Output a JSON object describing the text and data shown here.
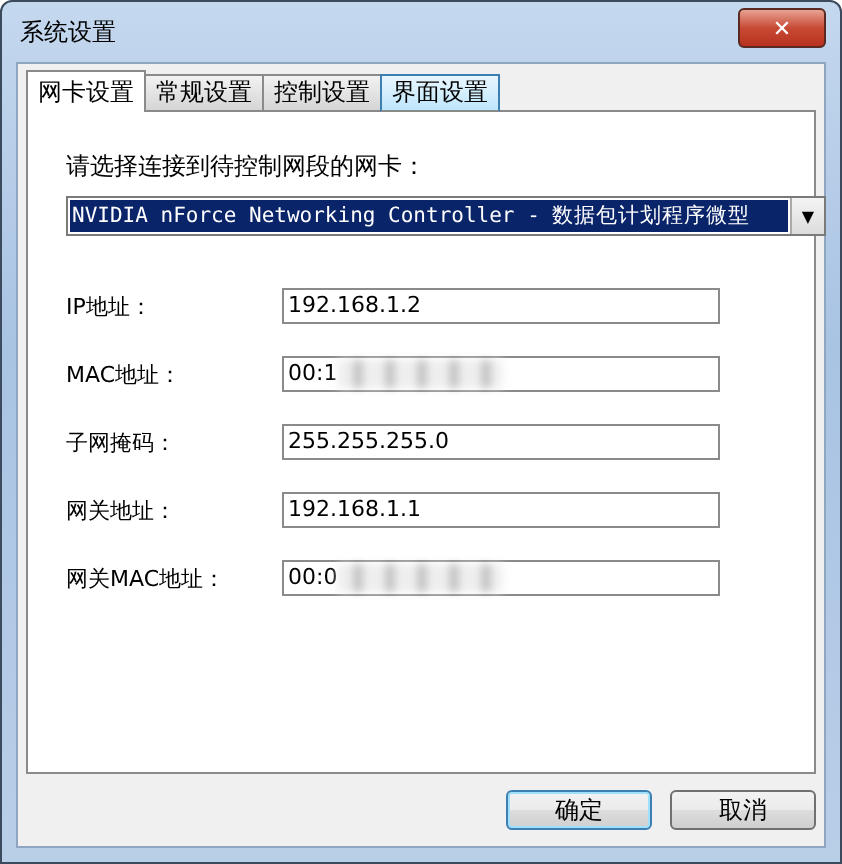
{
  "window": {
    "title": "系统设置",
    "close": "✕"
  },
  "tabs": [
    {
      "label": "网卡设置",
      "selected": true,
      "hovered": false
    },
    {
      "label": "常规设置",
      "selected": false,
      "hovered": false
    },
    {
      "label": "控制设置",
      "selected": false,
      "hovered": false
    },
    {
      "label": "界面设置",
      "selected": false,
      "hovered": true
    }
  ],
  "adapter": {
    "label": "请选择连接到待控制网段的网卡：",
    "value": "NVIDIA nForce Networking Controller - 数据包计划程序微型",
    "arrow": "▼"
  },
  "fields": [
    {
      "label": "IP地址：",
      "value": "192.168.1.2",
      "blurred": false
    },
    {
      "label": "MAC地址：",
      "value": "00:1",
      "blurred": true
    },
    {
      "label": "子网掩码：",
      "value": "255.255.255.0",
      "blurred": false
    },
    {
      "label": "网关地址：",
      "value": "192.168.1.1",
      "blurred": false
    },
    {
      "label": "网关MAC地址：",
      "value": "00:0",
      "blurred": true
    }
  ],
  "buttons": [
    {
      "label": "确定",
      "default": true
    },
    {
      "label": "取消",
      "default": false
    }
  ]
}
